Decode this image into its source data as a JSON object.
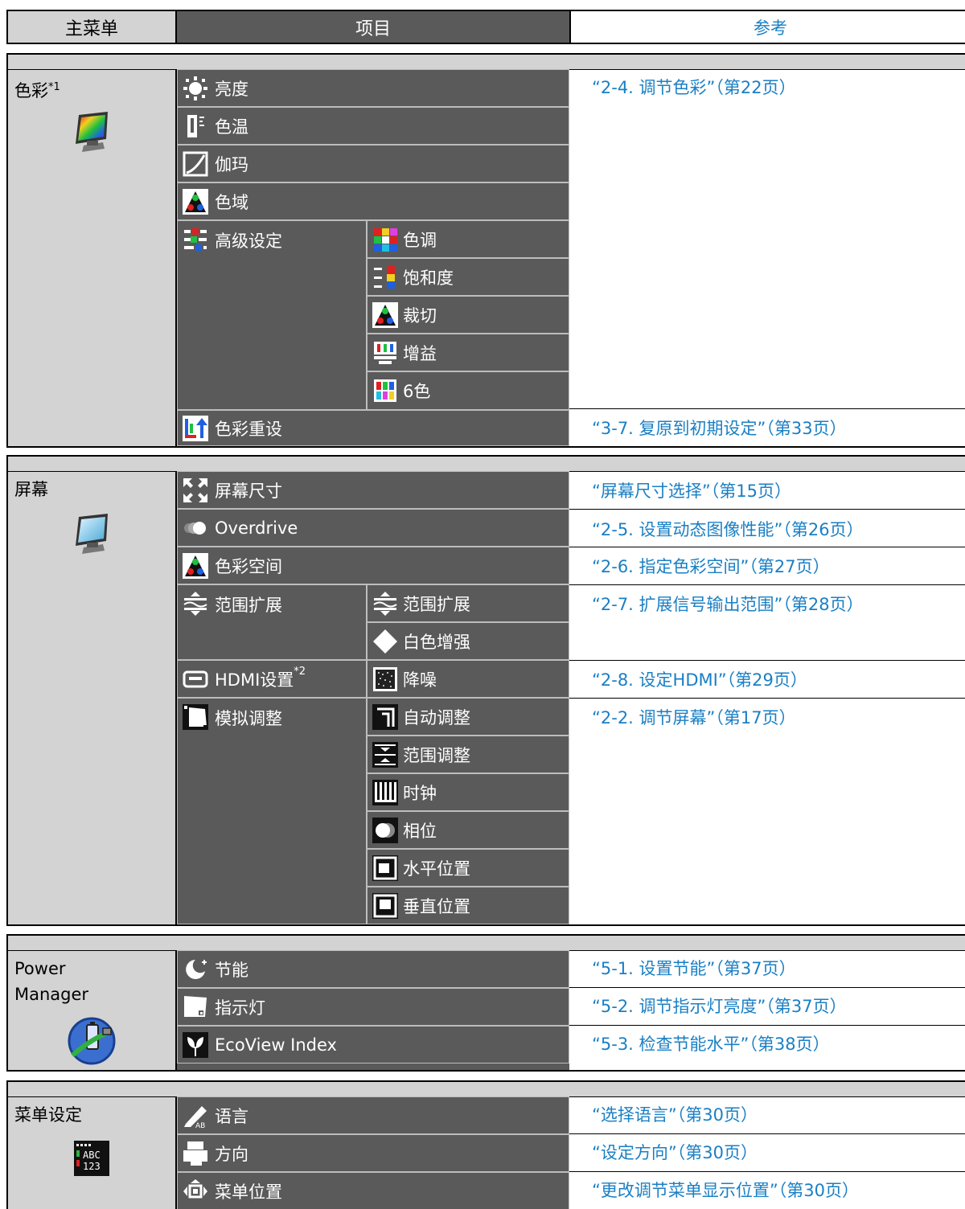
{
  "header": {
    "main_menu": "主菜单",
    "items": "项目",
    "reference": "参考"
  },
  "sections": {
    "color": {
      "label": "色彩",
      "footnote": "*1",
      "icon": "color-monitor-icon",
      "items": {
        "brightness": "亮度",
        "temperature": "色温",
        "gamma": "伽玛",
        "gamut": "色域",
        "advanced": "高级设定",
        "color_reset": "色彩重设"
      },
      "advanced_sub": {
        "hue": "色调",
        "saturation": "饱和度",
        "clipping": "裁切",
        "gain": "增益",
        "six_color": "6色"
      },
      "refs": {
        "adjust_color": "“2-4. 调节色彩”（第22页）",
        "reset": "“3-7. 复原到初期设定”（第33页）"
      }
    },
    "screen": {
      "label": "屏幕",
      "icon": "screen-monitor-icon",
      "items": {
        "screen_size": "屏幕尺寸",
        "overdrive": "Overdrive",
        "color_space": "色彩空间",
        "range_extension": "范围扩展",
        "hdmi": "HDMI设置",
        "hdmi_footnote": "*2",
        "analog": "模拟调整"
      },
      "range_sub": {
        "range_extension": "范围扩展",
        "white_enhance": "白色增强"
      },
      "hdmi_sub": {
        "noise_reduction": "降噪"
      },
      "analog_sub": {
        "auto_adjust": "自动调整",
        "range_adjust": "范围调整",
        "clock": "时钟",
        "phase": "相位",
        "h_position": "水平位置",
        "v_position": "垂直位置"
      },
      "refs": {
        "screen_size": "“屏幕尺寸选择”（第15页）",
        "overdrive": "“2-5. 设置动态图像性能”（第26页）",
        "color_space": "“2-6. 指定色彩空间”（第27页）",
        "range": "“2-7. 扩展信号输出范围”（第28页）",
        "hdmi": "“2-8. 设定HDMI”（第29页）",
        "analog": "“2-2. 调节屏幕”（第17页）"
      }
    },
    "power": {
      "label_line1": "Power",
      "label_line2": "Manager",
      "icon": "power-manager-icon",
      "items": {
        "eco": "节能",
        "indicator": "指示灯",
        "ecoview": "EcoView Index"
      },
      "refs": {
        "eco": "“5-1. 设置节能”（第37页）",
        "indicator": "“5-2. 调节指示灯亮度”（第37页）",
        "ecoview": "“5-3. 检查节能水平”（第38页）"
      }
    },
    "menu": {
      "label": "菜单设定",
      "icon": "abc-123-menu-icon",
      "items": {
        "language": "语言",
        "orientation": "方向",
        "menu_position": "菜单位置"
      },
      "refs": {
        "language": "“选择语言”（第30页）",
        "orientation": "“设定方向”（第30页）",
        "menu_position": "“更改调节菜单显示位置”（第30页）"
      }
    }
  },
  "colors": {
    "grey_light": "#d3d3d3",
    "grey_dark": "#5a5a5a",
    "link_blue": "#1a7fc4"
  }
}
